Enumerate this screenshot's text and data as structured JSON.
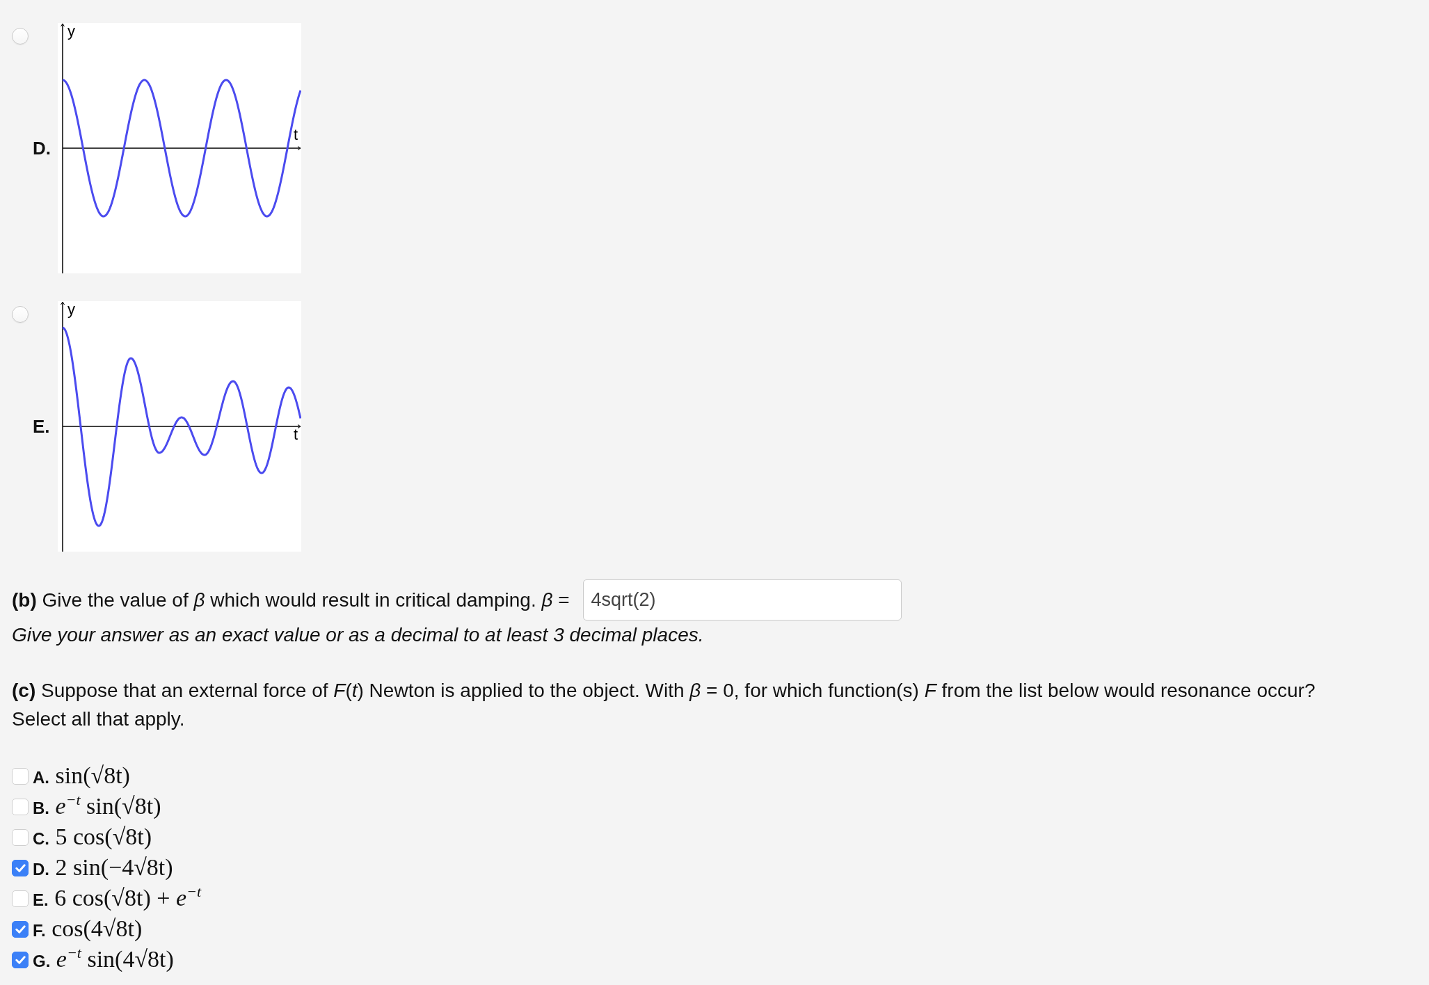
{
  "part_a": {
    "options": [
      {
        "letter": "D.",
        "selected": false,
        "kind": "steady",
        "y_label": "y",
        "t_label": "t"
      },
      {
        "letter": "E.",
        "selected": false,
        "kind": "transient",
        "y_label": "y",
        "t_label": "t"
      }
    ]
  },
  "part_b": {
    "prompt": "**(b)** Give the value of *β* which would result in critical damping. *β* =",
    "answer": "4sqrt(2)",
    "hint": "Give your answer as an exact value or as a decimal to at least 3 decimal places."
  },
  "part_c": {
    "prompt": "**(c)** Suppose that an external force of *F*(*t*) Newton is applied to the object. With *β* = 0, for which function(s) *F* from the list below would resonance occur?",
    "instruction": "Select all that apply.",
    "options": [
      {
        "label": "**A.** sin(√8t)",
        "checked": false
      },
      {
        "label": "**B.** *e*$^{−t}$ sin(√8t)",
        "checked": false
      },
      {
        "label": "**C.** 5 cos(√8t)",
        "checked": false
      },
      {
        "label": "**D.** 2 sin(−4√8t)",
        "checked": true
      },
      {
        "label": "**E.** 6 cos(√8t) + *e*$^{−t}$",
        "checked": false
      },
      {
        "label": "**F.** cos(4√8t)",
        "checked": true
      },
      {
        "label": "**G.** *e*$^{−t}$ sin(4√8t)",
        "checked": true
      }
    ]
  }
}
